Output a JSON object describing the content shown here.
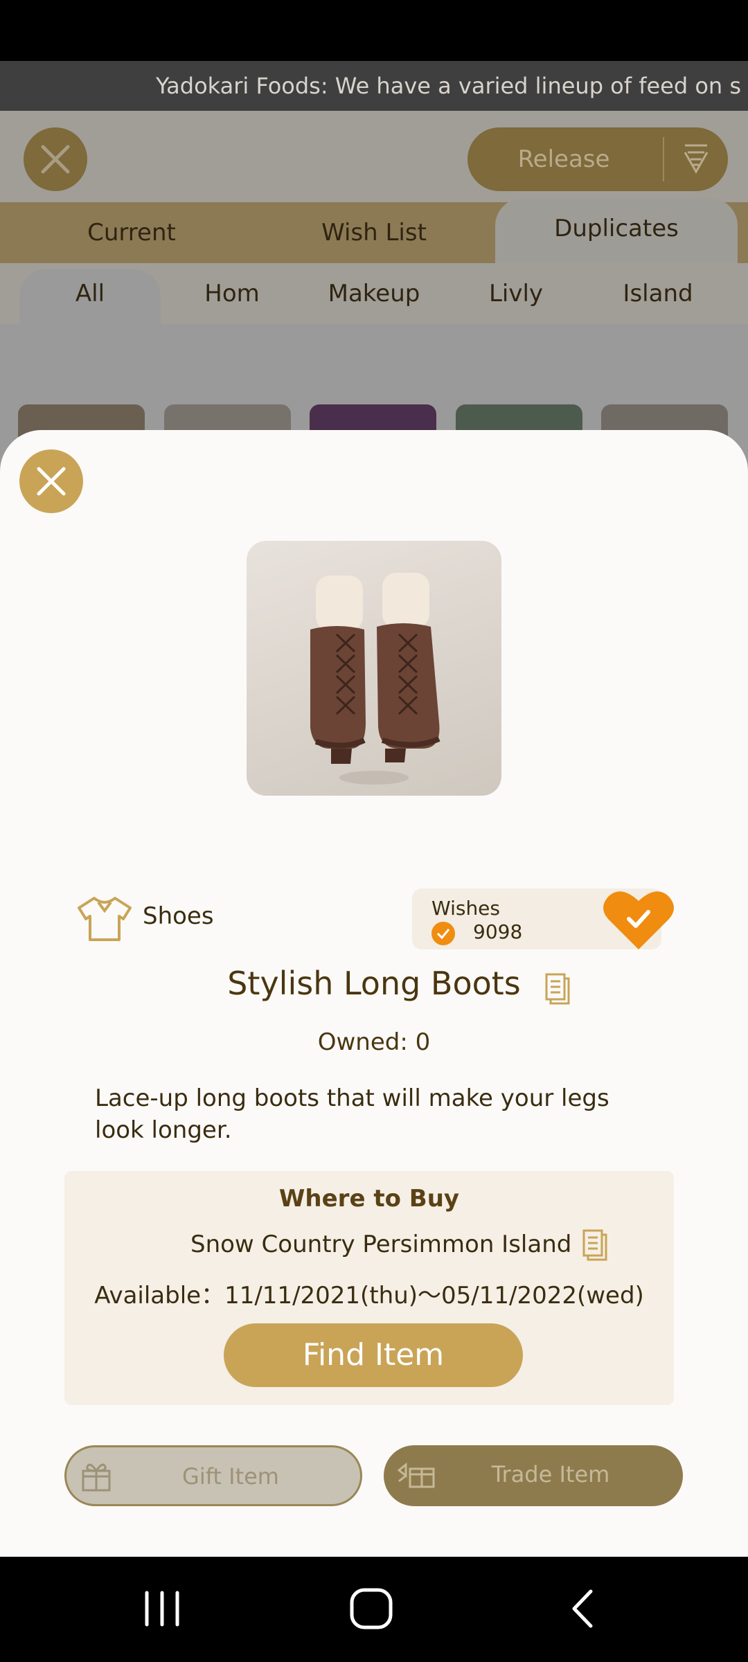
{
  "ticker": {
    "text": "Yadokari Foods: We have a varied lineup of feed on s"
  },
  "background": {
    "release_label": "Release",
    "tabs": [
      "Current",
      "Wish List",
      "Duplicates"
    ],
    "active_tab": "Duplicates",
    "categories": [
      "All",
      "Hom",
      "Makeup",
      "Livly",
      "Island"
    ],
    "active_category": "All"
  },
  "item": {
    "category": "Shoes",
    "wishes_label": "Wishes",
    "wishes_count": "9098",
    "name": "Stylish Long Boots",
    "owned": "Owned: 0",
    "description": "Lace-up long boots that will make your legs look longer."
  },
  "where_to_buy": {
    "title": "Where to Buy",
    "location": "Snow Country Persimmon Island",
    "available": "Available：11/11/2021(thu)～05/11/2022(wed)",
    "find_label": "Find Item"
  },
  "actions": {
    "gift_label": "Gift Item",
    "trade_label": "Trade Item"
  },
  "colors": {
    "accent": "#c9a457",
    "wish_orange": "#f08c10",
    "text_brown": "#5a4215"
  }
}
